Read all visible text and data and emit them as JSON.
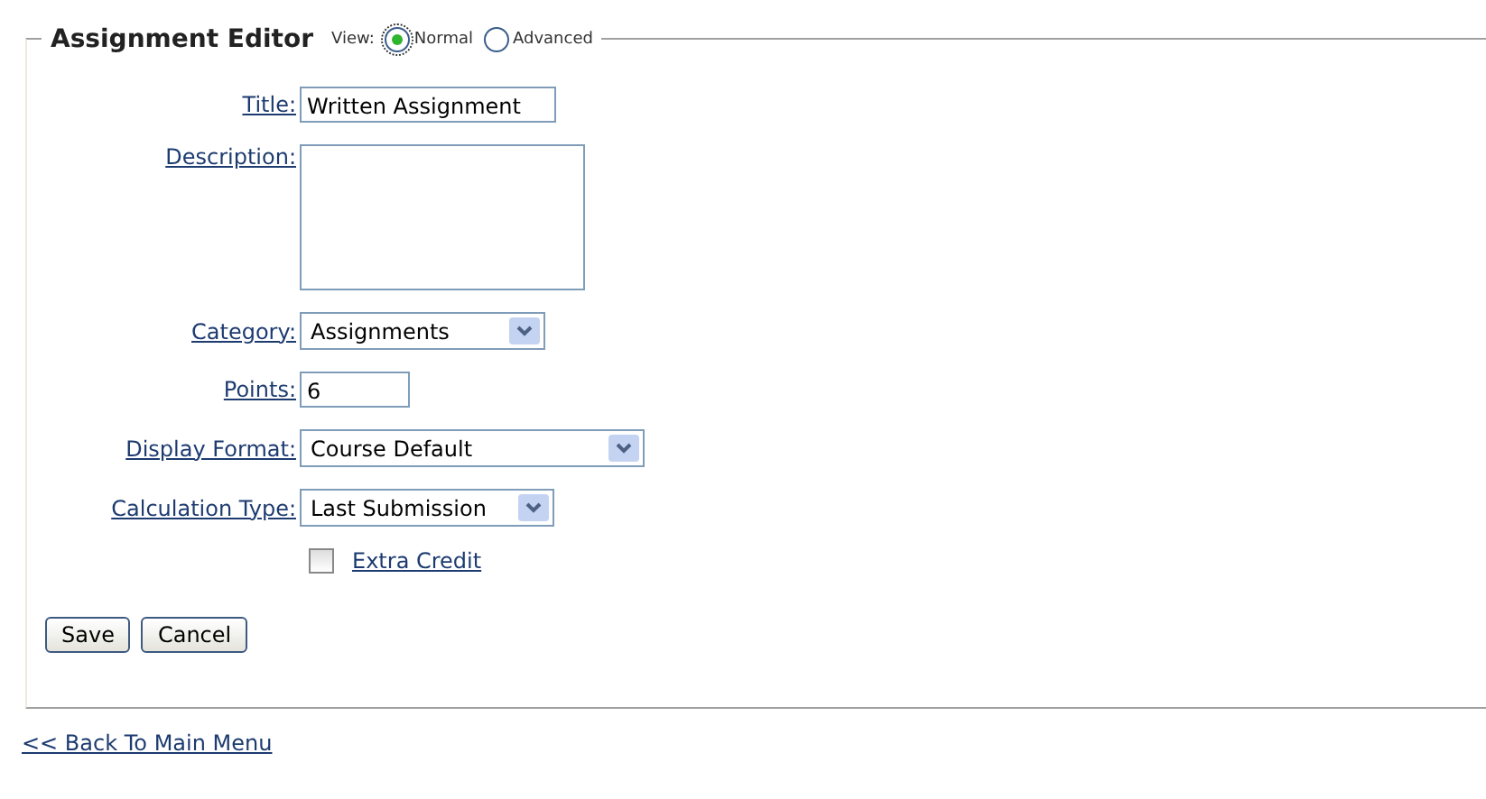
{
  "editor": {
    "title": "Assignment Editor",
    "view_label": "View:",
    "views": [
      {
        "label": "Normal",
        "selected": true
      },
      {
        "label": "Advanced",
        "selected": false
      }
    ],
    "fields": [
      {
        "kind": "text",
        "label": "Title:",
        "value": "Written Assignment"
      },
      {
        "kind": "textarea",
        "label": "Description:"
      },
      {
        "kind": "select",
        "label": "Category:",
        "value": "Assignments"
      },
      {
        "kind": "text",
        "label": "Points:",
        "value": "6"
      },
      {
        "kind": "select",
        "label": "Display Format:",
        "value": "Course Default"
      },
      {
        "kind": "select",
        "label": "Calculation Type:",
        "value": "Last Submission"
      },
      {
        "kind": "checkbox",
        "label": "Extra Credit",
        "checked": false
      }
    ],
    "buttons": [
      "Save",
      "Cancel"
    ]
  },
  "back_link": "<<  Back To Main Menu"
}
